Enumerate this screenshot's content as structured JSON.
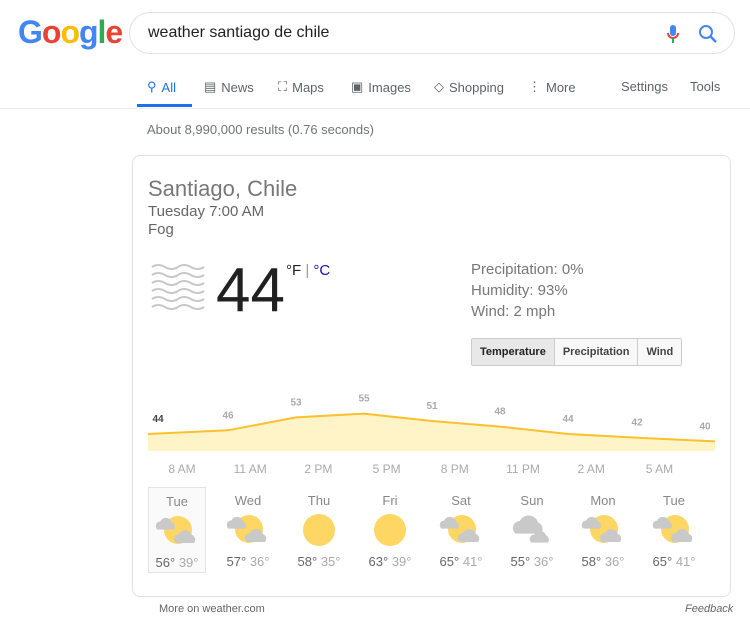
{
  "logo": "Google",
  "search": {
    "query": "weather santiago de chile"
  },
  "tabs": [
    {
      "label": "All",
      "icon": "search-icon"
    },
    {
      "label": "News",
      "icon": "news-icon"
    },
    {
      "label": "Maps",
      "icon": "map-icon"
    },
    {
      "label": "Images",
      "icon": "image-icon"
    },
    {
      "label": "Shopping",
      "icon": "tag-icon"
    },
    {
      "label": "More",
      "icon": "more-icon"
    }
  ],
  "tools": {
    "settings": "Settings",
    "tools": "Tools"
  },
  "stats": "About 8,990,000 results (0.76 seconds)",
  "weather": {
    "location": "Santiago, Chile",
    "time": "Tuesday 7:00 AM",
    "condition": "Fog",
    "icon": "fog-icon",
    "temperature": "44",
    "unit_f": "°F",
    "unit_sep": " | ",
    "unit_c": "°C",
    "precipitation": "Precipitation: 0%",
    "humidity": "Humidity: 93%",
    "wind": "Wind: 2 mph",
    "buttons": [
      "Temperature",
      "Precipitation",
      "Wind"
    ],
    "accent": "#fbc02d",
    "fill": "#fef4c8"
  },
  "chart_data": {
    "type": "area",
    "values": [
      44,
      46,
      53,
      55,
      51,
      48,
      44,
      42,
      40
    ],
    "x_labels": [
      "8 AM",
      "11 AM",
      "2 PM",
      "5 PM",
      "8 PM",
      "11 PM",
      "2 AM",
      "5 AM"
    ]
  },
  "forecast": [
    {
      "day": "Tue",
      "icon": "partly-cloudy-icon",
      "high": "56°",
      "low": "39°"
    },
    {
      "day": "Wed",
      "icon": "partly-cloudy-icon",
      "high": "57°",
      "low": "36°"
    },
    {
      "day": "Thu",
      "icon": "sunny-icon",
      "high": "58°",
      "low": "35°"
    },
    {
      "day": "Fri",
      "icon": "sunny-icon",
      "high": "63°",
      "low": "39°"
    },
    {
      "day": "Sat",
      "icon": "partly-cloudy-icon",
      "high": "65°",
      "low": "41°"
    },
    {
      "day": "Sun",
      "icon": "cloudy-icon",
      "high": "55°",
      "low": "36°"
    },
    {
      "day": "Mon",
      "icon": "partly-cloudy-icon",
      "high": "58°",
      "low": "36°"
    },
    {
      "day": "Tue",
      "icon": "partly-cloudy-icon",
      "high": "65°",
      "low": "41°"
    }
  ],
  "footer": {
    "more": "More on weather.com",
    "feedback": "Feedback"
  }
}
